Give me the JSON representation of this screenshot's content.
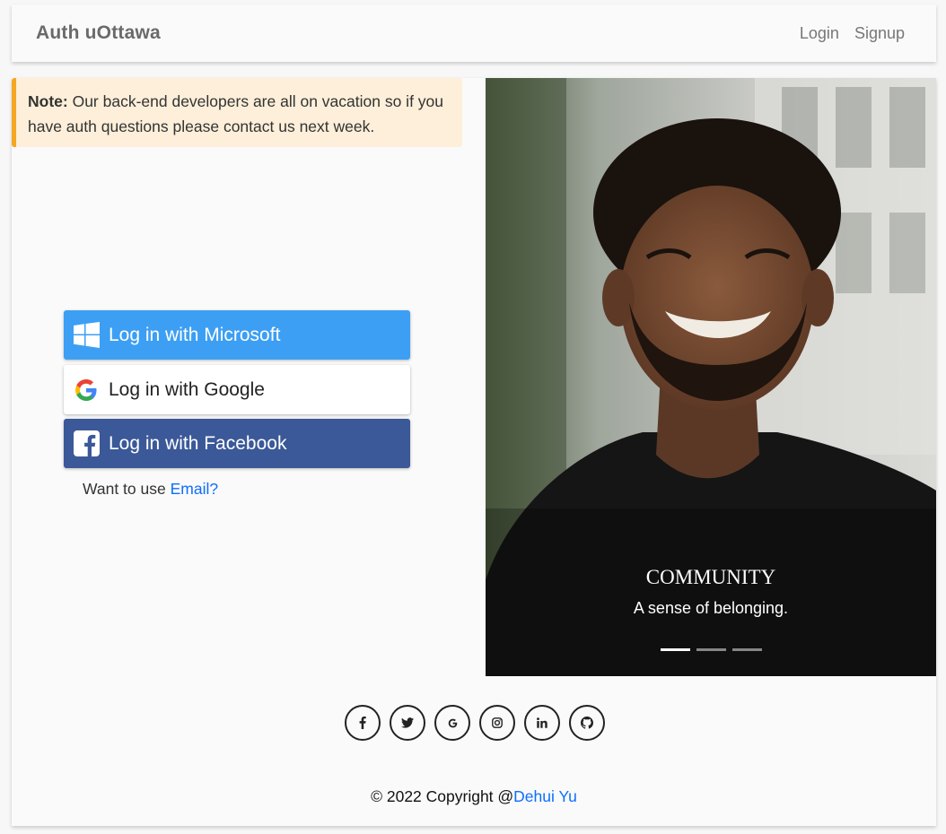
{
  "navbar": {
    "brand": "Auth uOttawa",
    "links": [
      "Login",
      "Signup"
    ]
  },
  "note": {
    "label": "Note:",
    "text": " Our back-end developers are all on vacation so if you have auth questions please contact us next week."
  },
  "auth_buttons": {
    "microsoft": "Log in with Microsoft",
    "google": "Log in with Google",
    "facebook": "Log in with Facebook"
  },
  "email_prompt": {
    "text": "Want to use ",
    "link": "Email?"
  },
  "carousel": {
    "title": "COMMUNITY",
    "subtitle": "A sense of belonging.",
    "slide_count": 3,
    "active_index": 0
  },
  "social_icons": [
    "facebook-icon",
    "twitter-icon",
    "google-icon",
    "instagram-icon",
    "linkedin-icon",
    "github-icon"
  ],
  "footer": {
    "copyright": "© 2022 Copyright @",
    "author": "Dehui Yu"
  },
  "colors": {
    "microsoft": "#3c9ff4",
    "facebook": "#3b5998",
    "note_bg": "#fdefd9",
    "note_border": "#f5a623",
    "link": "#0d6efd"
  }
}
